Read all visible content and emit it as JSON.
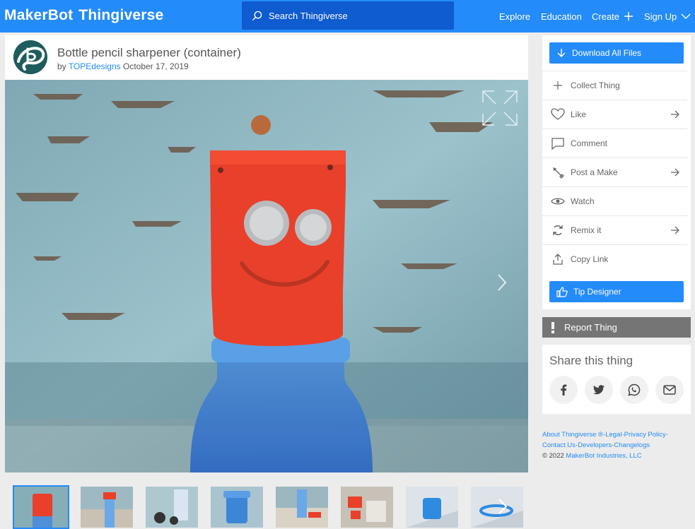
{
  "header": {
    "logo_left": "MakerBot",
    "logo_right": "Thingiverse",
    "search_placeholder": "Search Thingiverse",
    "nav": {
      "explore": "Explore",
      "education": "Education",
      "create": "Create",
      "signup": "Sign Up"
    }
  },
  "thing": {
    "title": "Bottle pencil sharpener (container)",
    "by": "by",
    "author": "TOPEdesigns",
    "date": "October 17, 2019"
  },
  "actions": {
    "download": "Download All Files",
    "collect": "Collect Thing",
    "like": "Like",
    "comment": "Comment",
    "post_make": "Post a Make",
    "watch": "Watch",
    "remix": "Remix it",
    "copy_link": "Copy Link",
    "tip": "Tip Designer"
  },
  "report": "Report Thing",
  "share": {
    "title": "Share this thing"
  },
  "footer": {
    "about": "About Thingiverse ®",
    "legal": "Legal",
    "privacy": "Privacy Policy",
    "contact": "Contact Us",
    "developers": "Developers",
    "changelogs": "Changelogs",
    "copyright": "©  2022",
    "company": "MakerBot Industries, LLC"
  },
  "colors": {
    "brand_blue": "#248bfb",
    "search_blue": "#0f5bd0",
    "report_gray": "#757575"
  }
}
